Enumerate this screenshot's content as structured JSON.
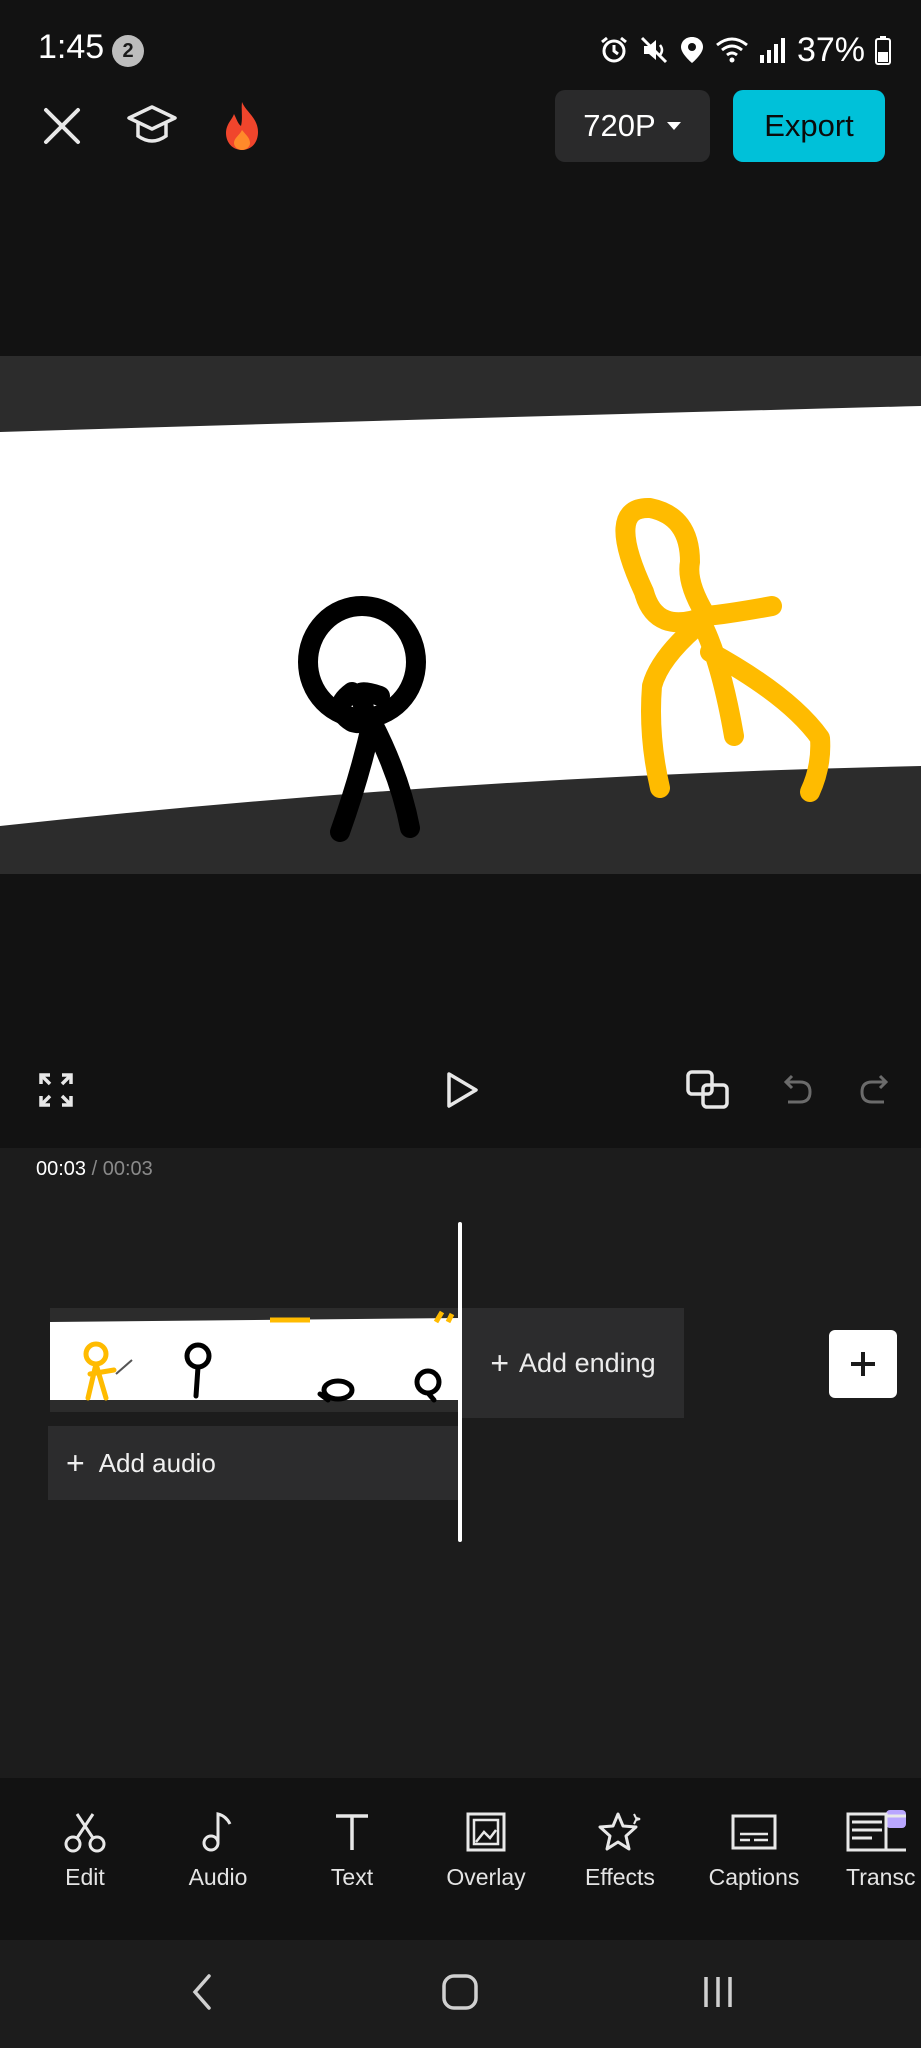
{
  "status_bar": {
    "time": "1:45",
    "notification_count": "2",
    "battery": "37%"
  },
  "toolbar": {
    "resolution": "720P",
    "export_label": "Export"
  },
  "timeline": {
    "current_time": "00:03",
    "separator": "/",
    "total_time": "00:03",
    "add_ending_label": "Add ending",
    "add_audio_label": "Add audio"
  },
  "tools": [
    {
      "label": "Edit",
      "icon": "scissors-icon"
    },
    {
      "label": "Audio",
      "icon": "music-note-icon"
    },
    {
      "label": "Text",
      "icon": "text-icon"
    },
    {
      "label": "Overlay",
      "icon": "overlay-icon"
    },
    {
      "label": "Effects",
      "icon": "star-icon"
    },
    {
      "label": "Captions",
      "icon": "captions-icon"
    },
    {
      "label": "Transc",
      "icon": "transcript-icon"
    }
  ],
  "colors": {
    "accent": "#00c1d9",
    "stickman_yellow": "#ffbb00",
    "background": "#121212"
  }
}
